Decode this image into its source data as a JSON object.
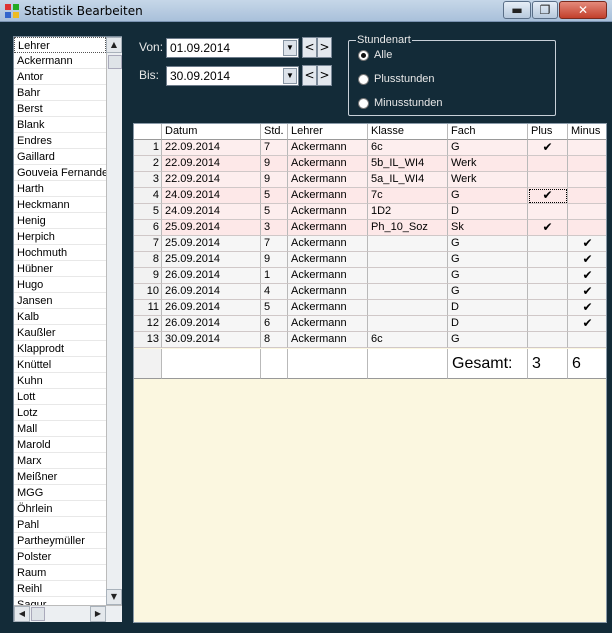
{
  "window": {
    "title": "Statistik Bearbeiten",
    "min_glyph": "▬",
    "max_glyph": "❐",
    "close_glyph": "✕"
  },
  "teachers": {
    "header": "Lehrer",
    "items": [
      "Ackermann",
      "Antor",
      "Bahr",
      "Berst",
      "Blank",
      "Endres",
      "Gaillard",
      "Gouveia Fernandes",
      "Harth",
      "Heckmann",
      "Henig",
      "Herpich",
      "Hochmuth",
      "Hübner",
      "Hugo",
      "Jansen",
      "Kalb",
      "Kaußler",
      "Klapprodt",
      "Knüttel",
      "Kuhn",
      "Lott",
      "Lotz",
      "Mall",
      "Marold",
      "Marx",
      "Meißner",
      "MGG",
      "Öhrlein",
      "Pahl",
      "Partheymüller",
      "Polster",
      "Raum",
      "Reihl",
      "Sagur"
    ]
  },
  "filters": {
    "from_label": "Von:",
    "from_value": "01.09.2014",
    "to_label": "Bis:",
    "to_value": "30.09.2014",
    "prev_glyph": "<",
    "next_glyph": ">"
  },
  "stundenart": {
    "title": "Stundenart",
    "options": [
      {
        "label": "Alle",
        "selected": true
      },
      {
        "label": "Plusstunden",
        "selected": false
      },
      {
        "label": "Minusstunden",
        "selected": false
      }
    ]
  },
  "grid": {
    "columns": [
      "Datum",
      "Std.",
      "Lehrer",
      "Klasse",
      "Fach",
      "Plus",
      "Minus"
    ],
    "rows": [
      {
        "n": "1",
        "datum": "22.09.2014",
        "std": "7",
        "lehrer": "Ackermann",
        "klasse": "6c",
        "fach": "G",
        "plus": "✔",
        "minus": ""
      },
      {
        "n": "2",
        "datum": "22.09.2014",
        "std": "9",
        "lehrer": "Ackermann",
        "klasse": "5b_IL_WI4",
        "fach": "Werk",
        "plus": "",
        "minus": ""
      },
      {
        "n": "3",
        "datum": "22.09.2014",
        "std": "9",
        "lehrer": "Ackermann",
        "klasse": "5a_IL_WI4",
        "fach": "Werk",
        "plus": "",
        "minus": ""
      },
      {
        "n": "4",
        "datum": "24.09.2014",
        "std": "5",
        "lehrer": "Ackermann",
        "klasse": "7c",
        "fach": "G",
        "plus": "✔",
        "minus": ""
      },
      {
        "n": "5",
        "datum": "24.09.2014",
        "std": "5",
        "lehrer": "Ackermann",
        "klasse": "1D2",
        "fach": "D",
        "plus": "",
        "minus": ""
      },
      {
        "n": "6",
        "datum": "25.09.2014",
        "std": "3",
        "lehrer": "Ackermann",
        "klasse": "Ph_10_Soz",
        "fach": "Sk",
        "plus": "✔",
        "minus": ""
      },
      {
        "n": "7",
        "datum": "25.09.2014",
        "std": "7",
        "lehrer": "Ackermann",
        "klasse": "",
        "fach": "G",
        "plus": "",
        "minus": "✔"
      },
      {
        "n": "8",
        "datum": "25.09.2014",
        "std": "9",
        "lehrer": "Ackermann",
        "klasse": "",
        "fach": "G",
        "plus": "",
        "minus": "✔"
      },
      {
        "n": "9",
        "datum": "26.09.2014",
        "std": "1",
        "lehrer": "Ackermann",
        "klasse": "",
        "fach": "G",
        "plus": "",
        "minus": "✔"
      },
      {
        "n": "10",
        "datum": "26.09.2014",
        "std": "4",
        "lehrer": "Ackermann",
        "klasse": "",
        "fach": "G",
        "plus": "",
        "minus": "✔"
      },
      {
        "n": "11",
        "datum": "26.09.2014",
        "std": "5",
        "lehrer": "Ackermann",
        "klasse": "",
        "fach": "D",
        "plus": "",
        "minus": "✔"
      },
      {
        "n": "12",
        "datum": "26.09.2014",
        "std": "6",
        "lehrer": "Ackermann",
        "klasse": "",
        "fach": "D",
        "plus": "",
        "minus": "✔"
      },
      {
        "n": "13",
        "datum": "30.09.2014",
        "std": "8",
        "lehrer": "Ackermann",
        "klasse": "6c",
        "fach": "G",
        "plus": "",
        "minus": ""
      }
    ],
    "total_label": "Gesamt:",
    "total_plus": "3",
    "total_minus": "6"
  },
  "colors": {
    "background": "#132b38",
    "grid_empty": "#fbf7e0",
    "row_tint": "#fdeeee"
  }
}
